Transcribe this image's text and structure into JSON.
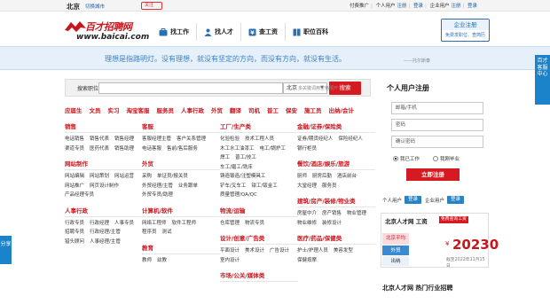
{
  "topbar": {
    "city": "北京",
    "switch_city": "切换城市",
    "weibo": "关注",
    "links": [
      "付费推广",
      "个人用户",
      "注册",
      "登录",
      "企业用户",
      "注册",
      "登录"
    ]
  },
  "header": {
    "logo_cn": "百才招聘网",
    "logo_en": "www.baicai.com",
    "nav": [
      "找工作",
      "找人才",
      "查工资",
      "职位百科"
    ],
    "employer_title": "企业注册",
    "employer_sub": "免费发职位、查简历"
  },
  "slogan": {
    "text": "理想是指路明灯。没有理想，就没有坚定的方向，而没有方向，就没有生活。",
    "author": "——托尔斯泰"
  },
  "service_tab": "百才客服中心",
  "share_tab": "分享",
  "search": {
    "label": "搜索职位",
    "placeholder": "",
    "city": "北京",
    "button": "搜索",
    "hint": "多关键词用空格隔开"
  },
  "hot_categories": [
    "应届生",
    "文员",
    "实习",
    "淘宝客服",
    "服务员",
    "人事行政",
    "外贸",
    "翻译",
    "司机",
    "普工",
    "保安",
    "施工员",
    "出纳/会计"
  ],
  "col1": [
    {
      "title": "销售",
      "items": [
        "电话销售",
        "销售代表",
        "销售经理",
        "渠道专员",
        "医药代表",
        "销售助理"
      ]
    },
    {
      "title": "网站制作",
      "items": [
        "网站编辑",
        "网站策划",
        "网站运营",
        "网站推广",
        "网页设计制作",
        "产品经理专员"
      ]
    },
    {
      "title": "人事行政",
      "items": [
        "行政专员",
        "行政经理",
        "人事专员",
        "招聘专员",
        "行政经理/主管",
        "猎头顾问",
        "人事经理/主管"
      ]
    }
  ],
  "col2": [
    {
      "title": "客服",
      "items": [
        "客服经理主管",
        "客户关系管理",
        "电话客服",
        "售前/售后服务"
      ]
    },
    {
      "title": "外贸",
      "items": [
        "采购",
        "单证员/报关员",
        "外贸经理/主管",
        "业务跟单",
        "外贸专员/助理"
      ]
    },
    {
      "title": "计算机/软件",
      "items": [
        "网络工程师",
        "软件工程师",
        "程序员",
        "测试"
      ]
    },
    {
      "title": "教育",
      "items": [
        "教师",
        "幼教"
      ]
    }
  ],
  "col3": [
    {
      "title": "工厂/生产类",
      "items": [
        "化验检验",
        "技术工程人员",
        "木工水工油漆工",
        "电工/锅炉工",
        "焊工",
        "普工/技工",
        "车工/磨工/铣床",
        "铸造锻造/注塑模具工",
        "铲车/叉车工",
        "钳工/钣金工",
        "质量管理/QA/QC"
      ]
    },
    {
      "title": "物流/运输",
      "items": [
        "仓库管理",
        "物流专员"
      ]
    },
    {
      "title": "设计/创意/广告类",
      "items": [
        "平面设计",
        "美术设计",
        "广告设计",
        "室内设计"
      ]
    },
    {
      "title": "市场/公关/媒体类",
      "items": []
    }
  ],
  "col4": [
    {
      "title": "金融/证券/保险类",
      "items": [
        "证券/期货经纪人",
        "保险经纪人",
        "银行柜员"
      ]
    },
    {
      "title": "餐饮/酒店/娱乐/旅游",
      "items": [
        "厨师",
        "厨房后勤",
        "酒店前台",
        "大堂经理",
        "服务员"
      ]
    },
    {
      "title": "建筑/房产/装修/物业类",
      "items": [
        "房屋中介",
        "房产销售",
        "物业管理",
        "物业维修",
        "装修设计"
      ]
    },
    {
      "title": "医疗/药品/保健类",
      "items": [
        "护士/护理人员",
        "美容发型",
        "保健按摩"
      ]
    }
  ],
  "register": {
    "title": "个人用户注册",
    "email_placeholder": "邮箱/手机",
    "password_placeholder": "密码",
    "confirm_placeholder": "确认密码",
    "radio_work": "我已工作",
    "radio_grad": "我刚毕业",
    "submit": "立即注册",
    "login_personal_label": "个人用户",
    "login_personal_btn": "登录",
    "login_company_label": "企业用户",
    "login_company_btn": "登录"
  },
  "wage": {
    "title": "北京人才网 工资",
    "badge": "免费查询工资",
    "avg": "北京平均",
    "tabs": [
      "外贸",
      "出纳"
    ],
    "currency": "¥",
    "value": "20230",
    "date": "截至2022年11月15日"
  },
  "hot_industry_title": "北京人才网 热门行业招聘"
}
